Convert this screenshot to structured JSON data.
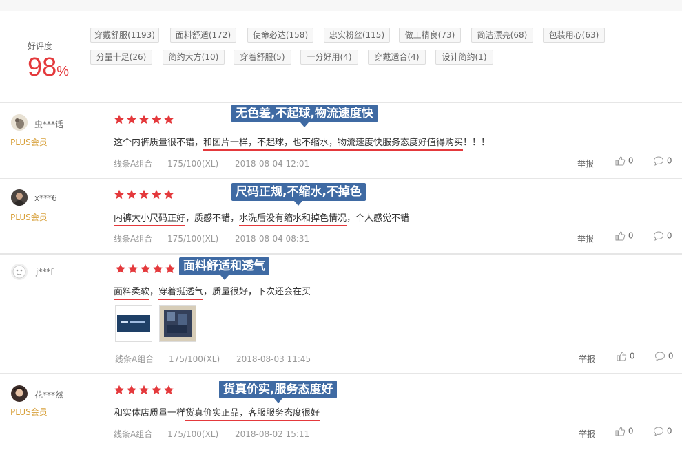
{
  "summary": {
    "rate_label": "好评度",
    "rate_value": "98",
    "rate_unit": "%",
    "tags": [
      "穿戴舒服(1193)",
      "面料舒适(172)",
      "使命必达(158)",
      "忠实粉丝(115)",
      "做工精良(73)",
      "简洁漂亮(68)",
      "包装用心(63)",
      "分量十足(26)",
      "简约大方(10)",
      "穿着舒服(5)",
      "十分好用(4)",
      "穿戴适合(4)",
      "设计简约(1)"
    ]
  },
  "reviews": [
    {
      "user": "虫***话",
      "member": "PLUS会员",
      "callout": "无色差,不起球,物流速度快",
      "content": {
        "t0": "这个内裤质量很不错，",
        "h1": "和图片一样，不起球，也不缩水，物流速度快服务态度好值得购买",
        "t1": "！！！"
      },
      "color": "线条A组合",
      "size": "175/100(XL)",
      "date": "2018-08-04 12:01",
      "report": "举报",
      "likes": "0",
      "comments": "0"
    },
    {
      "user": "x***6",
      "member": "PLUS会员",
      "callout": "尺码正规,不缩水,不掉色",
      "content": {
        "h0": "内裤大小尺码正好",
        "t0": "，质感不错，",
        "h1": "水洗后没有缩水和掉色情况",
        "t1": "，个人感觉不错"
      },
      "color": "线条A组合",
      "size": "175/100(XL)",
      "date": "2018-08-04 08:31",
      "report": "举报",
      "likes": "0",
      "comments": "0"
    },
    {
      "user": "j***f",
      "member": "",
      "callout": "面料舒适和透气",
      "content": {
        "h0": "面料柔软",
        "t0": "，",
        "h1": "穿着挺透气",
        "t1": "，质量很好，下次还会在买"
      },
      "color": "线条A组合",
      "size": "175/100(XL)",
      "date": "2018-08-03 11:45",
      "report": "举报",
      "likes": "0",
      "comments": "0"
    },
    {
      "user": "花***然",
      "member": "PLUS会员",
      "callout": "货真价实,服务态度好",
      "content": {
        "t0": "和实体店质量一样",
        "h1": "货真价实正品，客服服务态度很好"
      },
      "color": "线条A组合",
      "size": "175/100(XL)",
      "date": "2018-08-02 15:11",
      "report": "举报",
      "likes": "0",
      "comments": "0"
    }
  ],
  "colors": {
    "accent": "#e4393c",
    "callout": "#3f6aa3",
    "plus": "#d8a13c"
  }
}
